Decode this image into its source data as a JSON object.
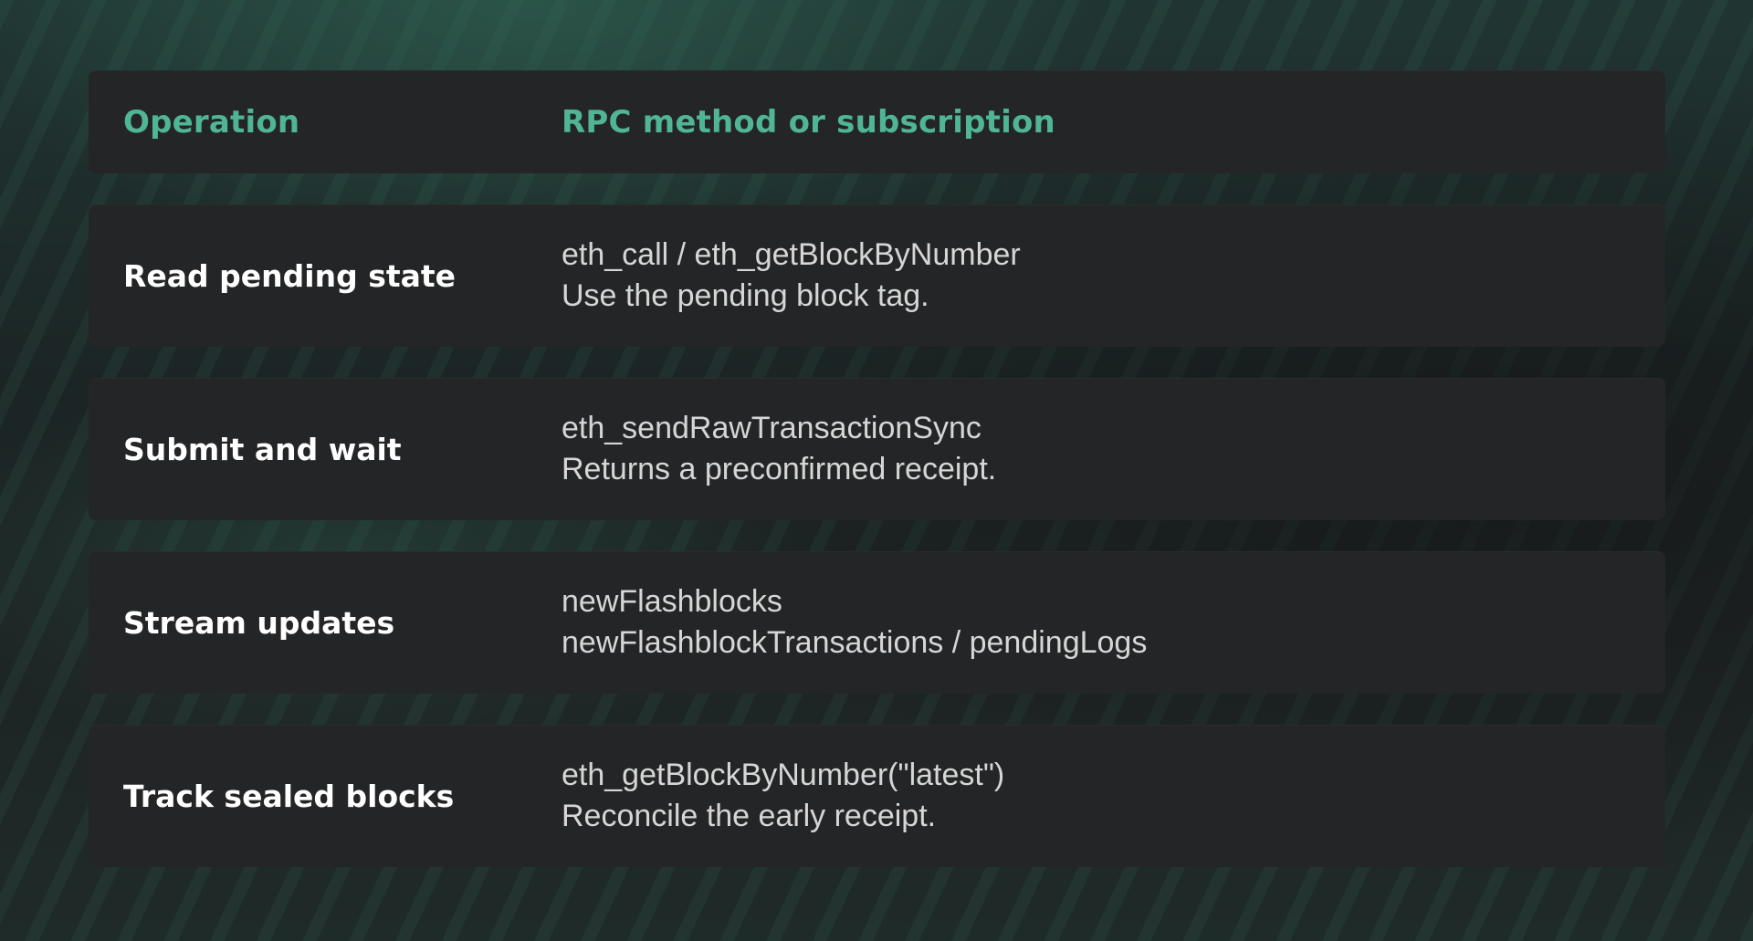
{
  "table": {
    "headers": {
      "operation": "Operation",
      "rpc": "RPC method or subscription"
    },
    "rows": [
      {
        "operation": "Read pending state",
        "rpc_line1": "eth_call / eth_getBlockByNumber",
        "rpc_line2": "Use the pending block tag."
      },
      {
        "operation": "Submit and wait",
        "rpc_line1": "eth_sendRawTransactionSync",
        "rpc_line2": "Returns a preconfirmed receipt."
      },
      {
        "operation": "Stream updates",
        "rpc_line1": "newFlashblocks",
        "rpc_line2": "newFlashblockTransactions / pendingLogs"
      },
      {
        "operation": "Track sealed blocks",
        "rpc_line1": "eth_getBlockByNumber(\"latest\")",
        "rpc_line2": "Reconcile the early receipt."
      }
    ]
  },
  "colors": {
    "header_text": "#4fb596",
    "operation_text": "#ffffff",
    "rpc_text": "#d6d6d6",
    "row_background": "#242526"
  }
}
